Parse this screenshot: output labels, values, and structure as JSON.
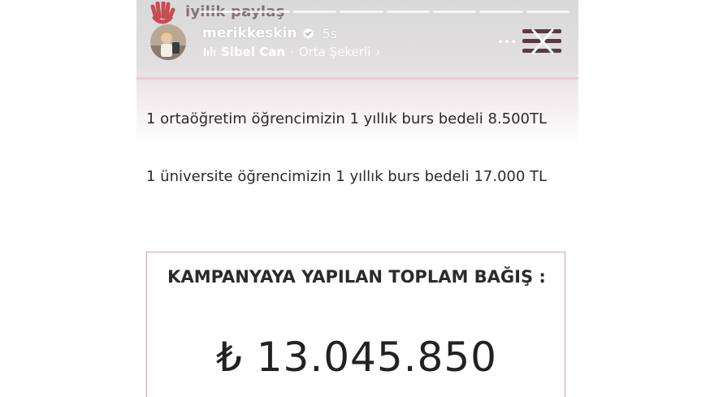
{
  "header": {
    "logo_text": "iyilik paylaş",
    "username": "merikkeskin",
    "time": "5s",
    "music": {
      "artist": "Sibel Can",
      "separator": "·",
      "song": "Orta Şekerli",
      "chevron": "›"
    },
    "progress_segments": 8,
    "icons": {
      "logo": "hand-logo-icon",
      "verified": "verified-badge-icon",
      "music": "music-bars-icon",
      "more": "more-dots-icon",
      "close": "close-icon"
    },
    "colors": {
      "accent_pink": "#cfa0a6",
      "logo_red": "#c4323c"
    }
  },
  "content": {
    "paragraph1": "1 ortaöğretim öğrencimizin 1 yıllık burs bedeli 8.500TL",
    "paragraph2": "1 üniversite öğrencimizin 1 yıllık burs bedeli 17.000 TL"
  },
  "campaign": {
    "title": "KAMPANYAYA YAPILAN TOPLAM BAĞIŞ :",
    "amount": "₺ 13.045.850"
  }
}
